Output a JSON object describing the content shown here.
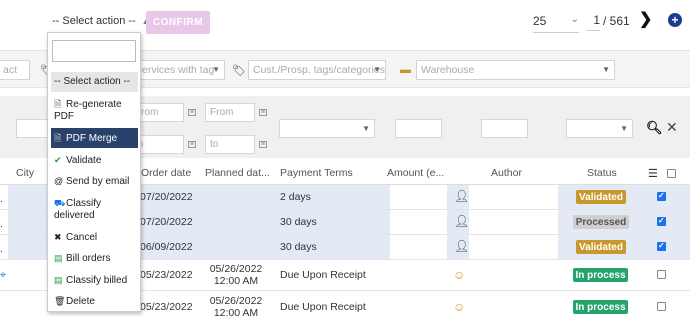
{
  "toolbar": {
    "select_action": "-- Select action --",
    "confirm": "CONFIRM",
    "page_size": "25",
    "page_current": "1",
    "page_total": "/ 561"
  },
  "filters": {
    "act": "act",
    "services_tag": "Services with tag",
    "cust_tags": "Cust./Prosp. tags/categories",
    "warehouse": "Warehouse"
  },
  "search": {
    "from": "From",
    "to": "to"
  },
  "columns": {
    "city": "City",
    "order_date": "Order date",
    "planned_date": "Planned dat...",
    "payment_terms": "Payment Terms",
    "amount": "Amount (e...",
    "author": "Author",
    "status": "Status"
  },
  "rows": [
    {
      "order_date": "07/20/2022",
      "planned": "",
      "terms": "2 days",
      "status": "Validated",
      "checked": true
    },
    {
      "order_date": "07/20/2022",
      "planned": "",
      "terms": "30 days",
      "status": "Processed",
      "checked": true
    },
    {
      "order_date": "06/09/2022",
      "planned": "",
      "terms": "30 days",
      "status": "Validated",
      "checked": true
    },
    {
      "order_date": "05/23/2022",
      "planned_date": "05/26/2022",
      "planned_time": "12:00 AM",
      "terms": "Due Upon Receipt",
      "status": "In process",
      "checked": false
    },
    {
      "order_date": "05/23/2022",
      "planned_date": "05/26/2022",
      "planned_time": "12:00 AM",
      "terms": "Due Upon Receipt",
      "status": "In process",
      "checked": false
    }
  ],
  "colors": {
    "validated": "#c9982c",
    "processed": "#cfcfcf",
    "in_process": "#25a36a",
    "confirm_bg": "#e9c7e7",
    "active_item": "#29426b"
  },
  "dropdown": {
    "items": [
      {
        "label": "-- Select action --",
        "icon": ""
      },
      {
        "label": "Re-generate PDF",
        "icon": "file-icon"
      },
      {
        "label": "PDF Merge",
        "icon": "file-icon"
      },
      {
        "label": "Validate",
        "icon": "check-icon"
      },
      {
        "label": "Send by email",
        "icon": "at-icon"
      },
      {
        "label": "Classify delivered",
        "icon": "truck-icon"
      },
      {
        "label": "Cancel",
        "icon": "x-icon"
      },
      {
        "label": "Bill orders",
        "icon": "bill-icon"
      },
      {
        "label": "Classify billed",
        "icon": "bill-icon"
      },
      {
        "label": "Delete",
        "icon": "trash-icon"
      }
    ]
  }
}
